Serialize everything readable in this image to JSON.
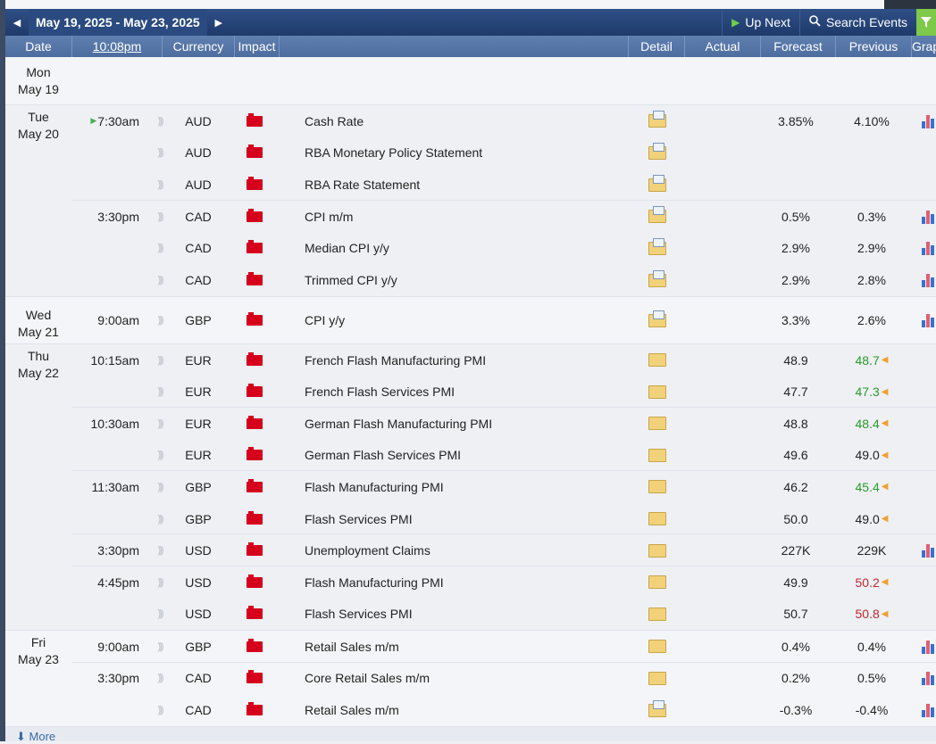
{
  "toolbar": {
    "date_range": "May 19, 2025 - May 23, 2025",
    "up_next": "Up Next",
    "search_events": "Search Events"
  },
  "columns": {
    "date": "Date",
    "time": "10:08pm",
    "currency": "Currency",
    "impact": "Impact",
    "detail": "Detail",
    "actual": "Actual",
    "forecast": "Forecast",
    "previous": "Previous",
    "graph": "Grap"
  },
  "colors": {
    "header_bar": "#1f3a6b",
    "high_impact": "#d6001c",
    "previous_better": "#2a9a2a",
    "previous_worse": "#c0282d"
  },
  "days": [
    {
      "day": "Mon",
      "date": "May 19"
    },
    {
      "day": "Tue",
      "date": "May 20"
    },
    {
      "day": "Wed",
      "date": "May 21"
    },
    {
      "day": "Thu",
      "date": "May 22"
    },
    {
      "day": "Fri",
      "date": "May 23"
    }
  ],
  "events": [
    {
      "time": "7:30am",
      "currency": "AUD",
      "event": "Cash Rate",
      "detail": "full",
      "forecast": "3.85%",
      "previous": "4.10%",
      "graph": true
    },
    {
      "time": "",
      "currency": "AUD",
      "event": "RBA Monetary Policy Statement",
      "detail": "full",
      "forecast": "",
      "previous": "",
      "graph": false
    },
    {
      "time": "",
      "currency": "AUD",
      "event": "RBA Rate Statement",
      "detail": "full",
      "forecast": "",
      "previous": "",
      "graph": false
    },
    {
      "time": "3:30pm",
      "currency": "CAD",
      "event": "CPI m/m",
      "detail": "full",
      "forecast": "0.5%",
      "previous": "0.3%",
      "graph": true
    },
    {
      "time": "",
      "currency": "CAD",
      "event": "Median CPI y/y",
      "detail": "full",
      "forecast": "2.9%",
      "previous": "2.9%",
      "graph": true
    },
    {
      "time": "",
      "currency": "CAD",
      "event": "Trimmed CPI y/y",
      "detail": "full",
      "forecast": "2.9%",
      "previous": "2.8%",
      "graph": true
    },
    {
      "time": "9:00am",
      "currency": "GBP",
      "event": "CPI y/y",
      "detail": "full",
      "forecast": "3.3%",
      "previous": "2.6%",
      "graph": true
    },
    {
      "time": "10:15am",
      "currency": "EUR",
      "event": "French Flash Manufacturing PMI",
      "detail": "empty",
      "forecast": "48.9",
      "previous": "48.7",
      "prev_state": "up",
      "graph": false
    },
    {
      "time": "",
      "currency": "EUR",
      "event": "French Flash Services PMI",
      "detail": "empty",
      "forecast": "47.7",
      "previous": "47.3",
      "prev_state": "up",
      "graph": false
    },
    {
      "time": "10:30am",
      "currency": "EUR",
      "event": "German Flash Manufacturing PMI",
      "detail": "empty",
      "forecast": "48.8",
      "previous": "48.4",
      "prev_state": "up",
      "graph": false
    },
    {
      "time": "",
      "currency": "EUR",
      "event": "German Flash Services PMI",
      "detail": "empty",
      "forecast": "49.6",
      "previous": "49.0",
      "prev_state": "same",
      "graph": false
    },
    {
      "time": "11:30am",
      "currency": "GBP",
      "event": "Flash Manufacturing PMI",
      "detail": "empty",
      "forecast": "46.2",
      "previous": "45.4",
      "prev_state": "up",
      "graph": false
    },
    {
      "time": "",
      "currency": "GBP",
      "event": "Flash Services PMI",
      "detail": "empty",
      "forecast": "50.0",
      "previous": "49.0",
      "prev_state": "same",
      "graph": false
    },
    {
      "time": "3:30pm",
      "currency": "USD",
      "event": "Unemployment Claims",
      "detail": "empty",
      "forecast": "227K",
      "previous": "229K",
      "graph": true
    },
    {
      "time": "4:45pm",
      "currency": "USD",
      "event": "Flash Manufacturing PMI",
      "detail": "empty",
      "forecast": "49.9",
      "previous": "50.2",
      "prev_state": "down",
      "graph": false
    },
    {
      "time": "",
      "currency": "USD",
      "event": "Flash Services PMI",
      "detail": "empty",
      "forecast": "50.7",
      "previous": "50.8",
      "prev_state": "down",
      "graph": false
    },
    {
      "time": "9:00am",
      "currency": "GBP",
      "event": "Retail Sales m/m",
      "detail": "empty",
      "forecast": "0.4%",
      "previous": "0.4%",
      "graph": true
    },
    {
      "time": "3:30pm",
      "currency": "CAD",
      "event": "Core Retail Sales m/m",
      "detail": "empty",
      "forecast": "0.2%",
      "previous": "0.5%",
      "graph": true
    },
    {
      "time": "",
      "currency": "CAD",
      "event": "Retail Sales m/m",
      "detail": "full",
      "forecast": "-0.3%",
      "previous": "-0.4%",
      "graph": true
    }
  ],
  "more": "More"
}
